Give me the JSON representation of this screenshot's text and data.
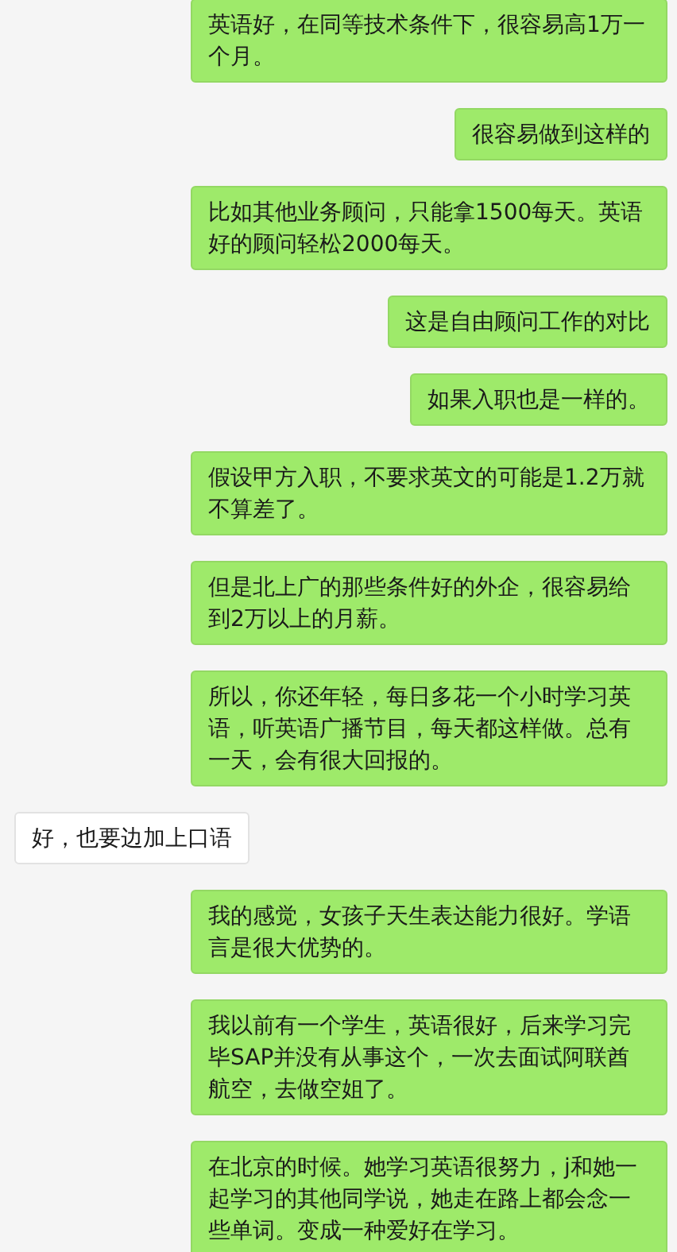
{
  "messages": [
    {
      "kind": "sent",
      "text": "英语好，在同等技术条件下，很容易高1万一个月。"
    },
    {
      "kind": "sent",
      "text": "很容易做到这样的"
    },
    {
      "kind": "sent",
      "text": "比如其他业务顾问，只能拿1500每天。英语好的顾问轻松2000每天。"
    },
    {
      "kind": "sent",
      "text": "这是自由顾问工作的对比"
    },
    {
      "kind": "sent",
      "text": "如果入职也是一样的。"
    },
    {
      "kind": "sent",
      "text": "假设甲方入职，不要求英文的可能是1.2万就不算差了。"
    },
    {
      "kind": "sent",
      "text": "但是北上广的那些条件好的外企，很容易给到2万以上的月薪。"
    },
    {
      "kind": "sent",
      "text": "所以，你还年轻，每日多花一个小时学习英语，听英语广播节目，每天都这样做。总有一天，会有很大回报的。"
    },
    {
      "kind": "received",
      "text": "好，也要边加上口语"
    },
    {
      "kind": "sent",
      "text": "我的感觉，女孩子天生表达能力很好。学语言是很大优势的。"
    },
    {
      "kind": "sent",
      "text": "我以前有一个学生，英语很好，后来学习完毕SAP并没有从事这个，一次去面试阿联酋航空，去做空姐了。"
    },
    {
      "kind": "sent",
      "text": "在北京的时候。她学习英语很努力，j和她一起学习的其他同学说，她走在路上都会念一些单词。变成一种爱好在学习。"
    }
  ]
}
